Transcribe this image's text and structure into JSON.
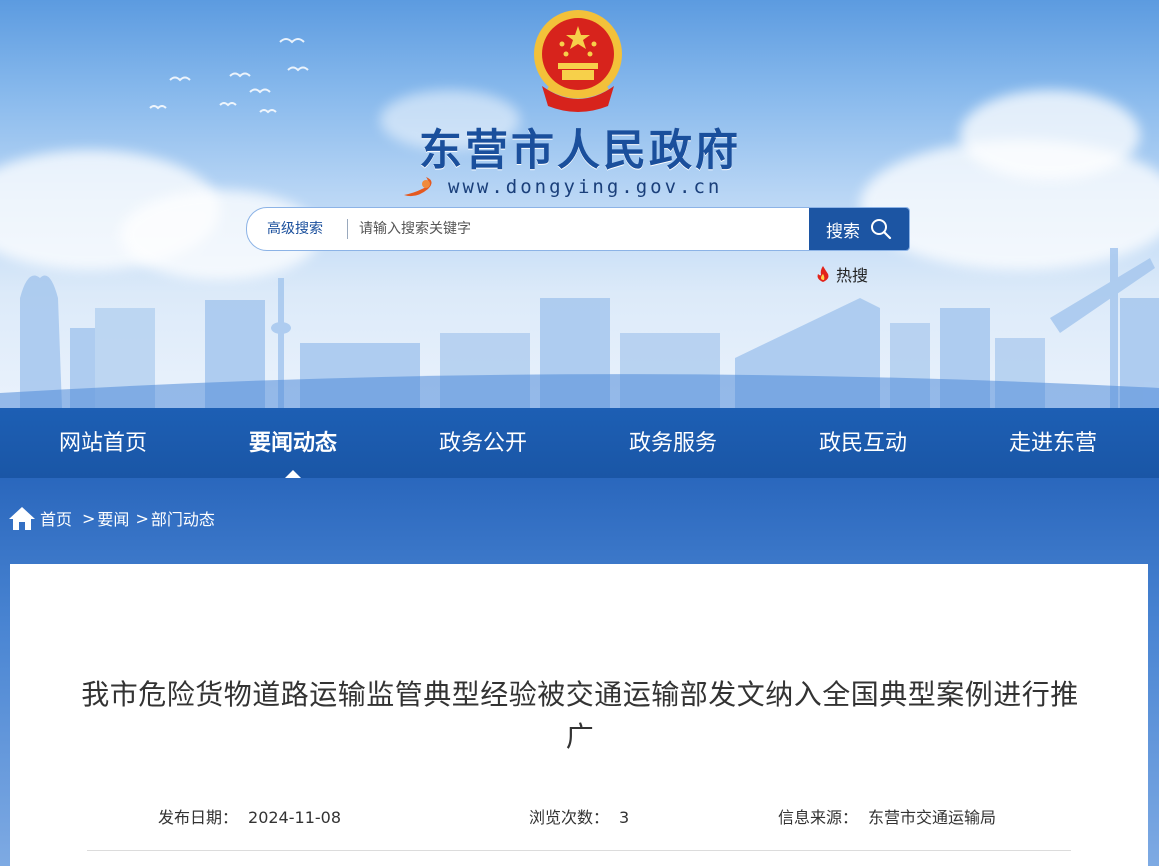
{
  "header": {
    "site_title": "东营市人民政府",
    "domain": "www.dongying.gov.cn",
    "emblem": "national-emblem",
    "colors": {
      "brand_blue": "#1a4f9c",
      "nav_blue": "#1d5fb4",
      "emblem_red": "#d7231c",
      "emblem_gold": "#f3c13a"
    }
  },
  "search": {
    "advanced_label": "高级搜索",
    "placeholder": "请输入搜索关键字",
    "button_label": "搜索",
    "hot_label": "热搜"
  },
  "nav": {
    "items": [
      {
        "label": "网站首页"
      },
      {
        "label": "要闻动态",
        "active": true
      },
      {
        "label": "政务公开"
      },
      {
        "label": "政务服务"
      },
      {
        "label": "政民互动"
      },
      {
        "label": "走进东营"
      }
    ]
  },
  "breadcrumb": {
    "home": "首页",
    "items": [
      "要闻",
      "部门动态"
    ],
    "separator": ">"
  },
  "article": {
    "title": "我市危险货物道路运输监管典型经验被交通运输部发文纳入全国典型案例进行推广",
    "meta": {
      "date_label": "发布日期：",
      "date_value": "2024-11-08",
      "views_label": "浏览次数：",
      "views_value": "3",
      "source_label": "信息来源：",
      "source_value": "东营市交通运输局"
    }
  }
}
